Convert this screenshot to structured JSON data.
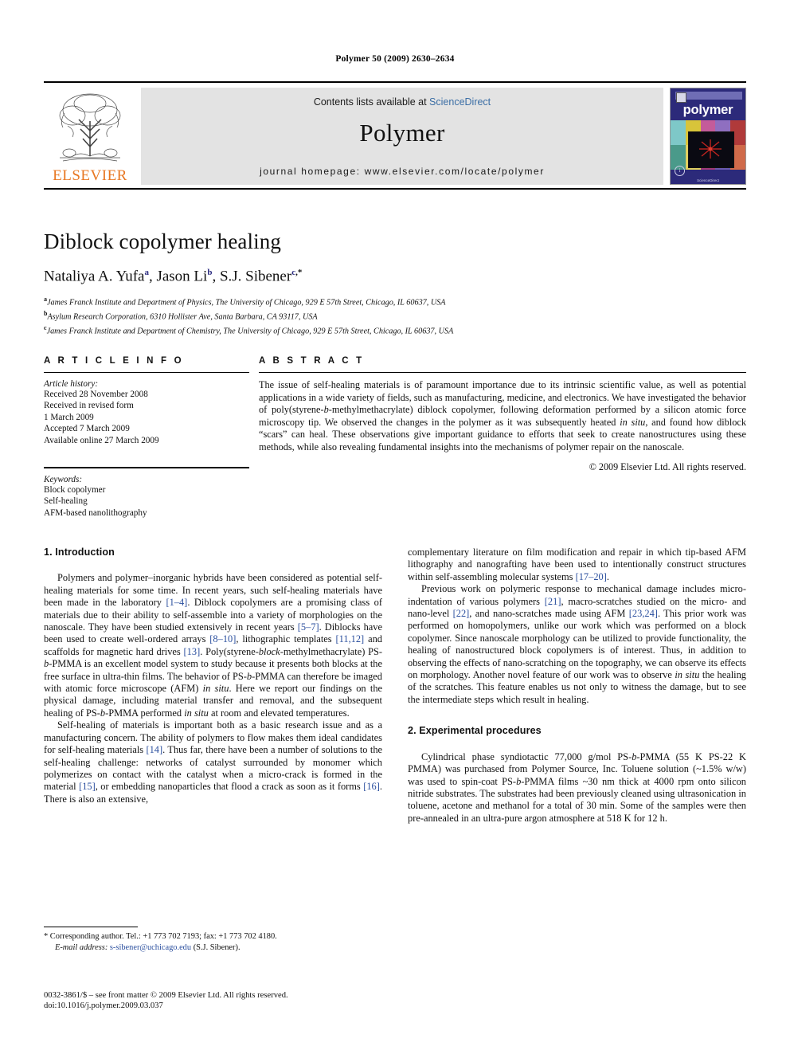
{
  "running_head": "Polymer 50 (2009) 2630–2634",
  "masthead": {
    "contents_prefix": "Contents lists available at ",
    "sciencedirect": "ScienceDirect",
    "journal_name": "Polymer",
    "homepage": "journal homepage: www.elsevier.com/locate/polymer",
    "publisher": "ELSEVIER",
    "cover_title": "polymer",
    "cover_caption": "ScienceDirect",
    "accent_orange": "#E87722",
    "link_blue": "#3b6ea5",
    "cover_blue": "#2c2a7a"
  },
  "article": {
    "title": "Diblock copolymer healing",
    "authors": [
      {
        "name": "Nataliya A. Yufa",
        "sup": "a",
        "sep": ", "
      },
      {
        "name": "Jason Li",
        "sup": "b",
        "sep": ", "
      },
      {
        "name": "S.J. Sibener",
        "sup": "c",
        "sep": ""
      }
    ],
    "corresponding_marker": ",*",
    "affiliations": [
      {
        "marker": "a",
        "text": "James Franck Institute and Department of Physics, The University of Chicago, 929 E 57th Street, Chicago, IL 60637, USA"
      },
      {
        "marker": "b",
        "text": "Asylum Research Corporation, 6310 Hollister Ave, Santa Barbara, CA 93117, USA"
      },
      {
        "marker": "c",
        "text": "James Franck Institute and Department of Chemistry, The University of Chicago, 929 E 57th Street, Chicago, IL 60637, USA"
      }
    ]
  },
  "article_info": {
    "heading": "A R T I C L E   I N F O",
    "history_label": "Article history:",
    "history": [
      "Received 28 November 2008",
      "Received in revised form",
      "1 March 2009",
      "Accepted 7 March 2009",
      "Available online 27 March 2009"
    ],
    "keywords_label": "Keywords:",
    "keywords": [
      "Block copolymer",
      "Self-healing",
      "AFM-based nanolithography"
    ]
  },
  "abstract": {
    "heading": "A B S T R A C T",
    "paragraph_1": "The issue of self-healing materials is of paramount importance due to its intrinsic scientific value, as well as potential applications in a wide variety of fields, such as manufacturing, medicine, and electronics. We have investigated the behavior of poly(styrene-",
    "italic_1": "b",
    "paragraph_1b": "-methylmethacrylate) diblock copolymer, following deformation performed by a silicon atomic force microscopy tip. We observed the changes in the polymer as it was subsequently heated ",
    "italic_2": "in situ",
    "paragraph_1c": ", and found how diblock “scars” can heal. These observations give important guidance to efforts that seek to create nanostructures using these methods, while also revealing fundamental insights into the mechanisms of polymer repair on the nanoscale.",
    "copyright": "© 2009 Elsevier Ltd. All rights reserved."
  },
  "body": {
    "section_1_heading": "1.  Introduction",
    "section_2_heading": "2.  Experimental procedures",
    "left": {
      "p1_a": "Polymers and polymer–inorganic hybrids have been considered as potential self-healing materials for some time. In recent years, such self-healing materials have been made in the laboratory ",
      "p1_ref1": "[1–4]",
      "p1_b": ". Diblock copolymers are a promising class of materials due to their ability to self-assemble into a variety of morphologies on the nanoscale. They have been studied extensively in recent years ",
      "p1_ref2": "[5–7]",
      "p1_c": ". Diblocks have been used to create well-ordered arrays ",
      "p1_ref3": "[8–10]",
      "p1_d": ", lithographic templates ",
      "p1_ref4": "[11,12]",
      "p1_e": " and scaffolds for magnetic hard drives ",
      "p1_ref5": "[13]",
      "p1_f": ". Poly(styrene-",
      "p1_it1": "block",
      "p1_g": "-methylmethacrylate) PS-",
      "p1_it2": "b",
      "p1_h": "-PMMA is an excellent model system to study because it presents both blocks at the free surface in ultra-thin films. The behavior of PS-",
      "p1_it3": "b",
      "p1_i": "-PMMA can therefore be imaged with atomic force microscope (AFM) ",
      "p1_it4": "in situ",
      "p1_j": ". Here we report our findings on the physical damage, including material transfer and removal, and the subsequent healing of PS-",
      "p1_it5": "b",
      "p1_k": "-PMMA performed ",
      "p1_it6": "in situ",
      "p1_l": " at room and elevated temperatures.",
      "p2_a": "Self-healing of materials is important both as a basic research issue and as a manufacturing concern. The ability of polymers to flow makes them ideal candidates for self-healing materials ",
      "p2_ref1": "[14]",
      "p2_b": ". Thus far, there have been a number of solutions to the self-healing challenge: networks of catalyst surrounded by monomer which polymerizes on contact with the catalyst when a micro-crack is formed in the material ",
      "p2_ref2": "[15]",
      "p2_c": ", or embedding nanoparticles that flood a crack as soon as it forms ",
      "p2_ref3": "[16]",
      "p2_d": ". There is also an extensive,"
    },
    "right": {
      "p1_a": "complementary literature on film modification and repair in which tip-based AFM lithography and nanografting have been used to intentionally construct structures within self-assembling molecular systems ",
      "p1_ref1": "[17–20]",
      "p1_b": ".",
      "p2_a": "Previous work on polymeric response to mechanical damage includes micro-indentation of various polymers ",
      "p2_ref1": "[21]",
      "p2_b": ", macro-scratches studied on the micro- and nano-level ",
      "p2_ref2": "[22]",
      "p2_c": ", and nano-scratches made using AFM ",
      "p2_ref3": "[23,24]",
      "p2_d": ". This prior work was performed on homopolymers, unlike our work which was performed on a block copolymer. Since nanoscale morphology can be utilized to provide functionality, the healing of nanostructured block copolymers is of interest. Thus, in addition to observing the effects of nano-scratching on the topography, we can observe its effects on morphology. Another novel feature of our work was to observe ",
      "p2_it1": "in situ",
      "p2_e": " the healing of the scratches. This feature enables us not only to witness the damage, but to see the intermediate steps which result in healing.",
      "p3_a": "Cylindrical phase syndiotactic 77,000 g/mol PS-",
      "p3_it1": "b",
      "p3_b": "-PMMA (55 K PS-22 K PMMA) was purchased from Polymer Source, Inc. Toluene solution (~1.5% w/w) was used to spin-coat PS-",
      "p3_it2": "b",
      "p3_c": "-PMMA films ~30 nm thick at 4000 rpm onto silicon nitride substrates. The substrates had been previously cleaned using ultrasonication in toluene, acetone and methanol for a total of 30 min. Some of the samples were then pre-annealed in an ultra-pure argon atmosphere at 518 K for 12 h."
    }
  },
  "footnote": {
    "marker": "*",
    "corresponding": " Corresponding author. Tel.: +1 773 702 7193; fax: +1 773 702 4180.",
    "email_label": "E-mail address:",
    "email": "s-sibener@uchicago.edu",
    "email_owner": "(S.J. Sibener)."
  },
  "page_footer": {
    "line1": "0032-3861/$ – see front matter © 2009 Elsevier Ltd. All rights reserved.",
    "line2": "doi:10.1016/j.polymer.2009.03.037"
  }
}
